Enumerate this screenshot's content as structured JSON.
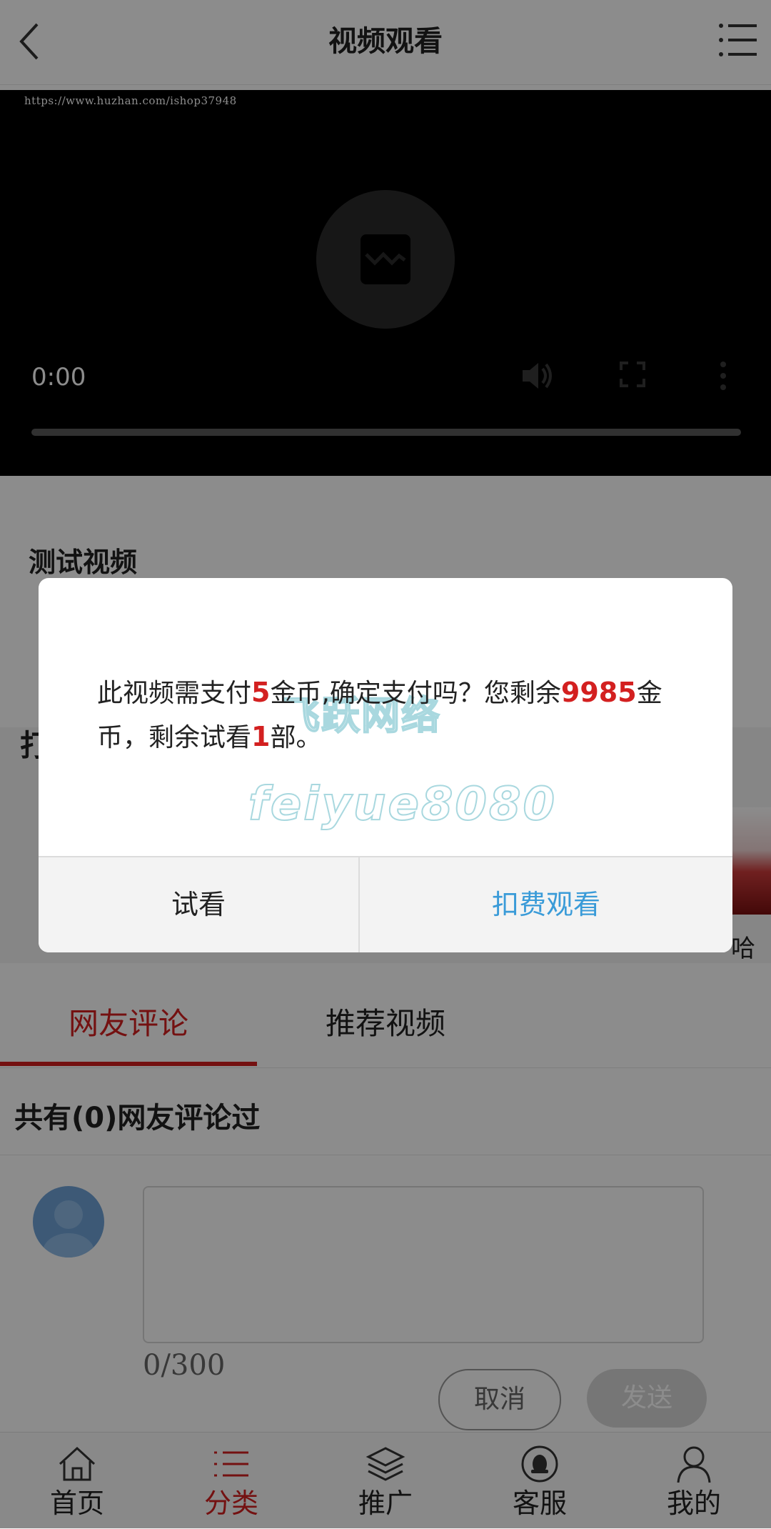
{
  "header": {
    "title": "视频观看"
  },
  "video": {
    "watermark_url": "https://www.huzhan.com/ishop37948",
    "time": "0:00"
  },
  "info": {
    "video_title": "测试视频",
    "section_partial": "打",
    "thumb_partial_label": "哈"
  },
  "tabs": [
    {
      "label": "网友评论",
      "active": true
    },
    {
      "label": "推荐视频",
      "active": false
    }
  ],
  "comments": {
    "count_text": "共有(0)网友评论过",
    "char_count": "0/300",
    "cancel_label": "取消",
    "send_label": "发送"
  },
  "nav": [
    {
      "label": "首页",
      "icon": "home-icon",
      "active": false
    },
    {
      "label": "分类",
      "icon": "list-icon",
      "active": true
    },
    {
      "label": "推广",
      "icon": "layers-icon",
      "active": false
    },
    {
      "label": "客服",
      "icon": "qq-icon",
      "active": false
    },
    {
      "label": "我的",
      "icon": "user-icon",
      "active": false
    }
  ],
  "dialog": {
    "msg_part1": "此视频需支付",
    "price": "5",
    "msg_part2": "金币,确定支付吗？您剩余",
    "balance": "9985",
    "msg_part3": "金币，剩余试看",
    "trials": "1",
    "msg_part4": "部。",
    "watermark_cn": "飞跃网络",
    "watermark_en": "feiyue8080",
    "trial_label": "试看",
    "pay_label": "扣费观看"
  },
  "colors": {
    "accent_red": "#d32020",
    "link_blue": "#3a9bd8"
  }
}
